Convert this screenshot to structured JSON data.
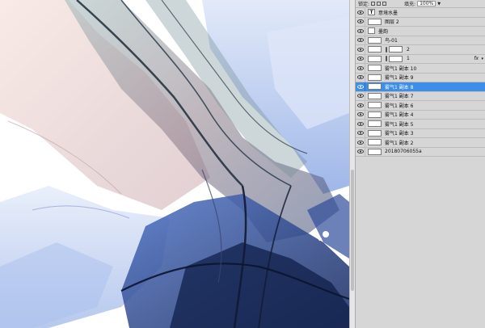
{
  "panel": {
    "lock_label": "锁定:",
    "fill_label": "填充:",
    "fill_value": "100%",
    "fill_dropdown": "▼"
  },
  "layers": [
    {
      "name": "意境水墨",
      "thumb": "text",
      "selected": false,
      "fx": false
    },
    {
      "name": "图层 2",
      "thumb": "normal",
      "selected": false,
      "fx": false
    },
    {
      "name": "墨韵",
      "thumb": "group",
      "selected": false,
      "fx": false
    },
    {
      "name": "鸟-01",
      "thumb": "normal",
      "selected": false,
      "fx": false
    },
    {
      "name": "2",
      "thumb": "masked",
      "selected": false,
      "fx": false
    },
    {
      "name": "1",
      "thumb": "masked",
      "selected": false,
      "fx": true
    },
    {
      "name": "雾气1 副本 10",
      "thumb": "normal",
      "selected": false,
      "fx": false
    },
    {
      "name": "雾气1 副本 9",
      "thumb": "normal",
      "selected": false,
      "fx": false
    },
    {
      "name": "雾气1 副本 8",
      "thumb": "normal",
      "selected": true,
      "fx": false
    },
    {
      "name": "雾气1 副本 7",
      "thumb": "normal",
      "selected": false,
      "fx": false
    },
    {
      "name": "雾气1 副本 6",
      "thumb": "normal",
      "selected": false,
      "fx": false
    },
    {
      "name": "雾气1 副本 4",
      "thumb": "normal",
      "selected": false,
      "fx": false
    },
    {
      "name": "雾气1 副本 5",
      "thumb": "normal",
      "selected": false,
      "fx": false
    },
    {
      "name": "雾气1 副本 3",
      "thumb": "normal",
      "selected": false,
      "fx": false
    },
    {
      "name": "雾气1 副本 2",
      "thumb": "normal",
      "selected": false,
      "fx": false
    },
    {
      "name": "20180706055a",
      "thumb": "normal",
      "selected": false,
      "fx": false
    }
  ],
  "fx_label": "fx",
  "fx_arrow": "▾",
  "colors": {
    "selection": "#3d8ee8",
    "panel_bg": "#d6d6d6",
    "ink_dark": "#0f1f4a",
    "ink_blue": "#3b66c9",
    "ink_mauve": "#b48a96"
  }
}
